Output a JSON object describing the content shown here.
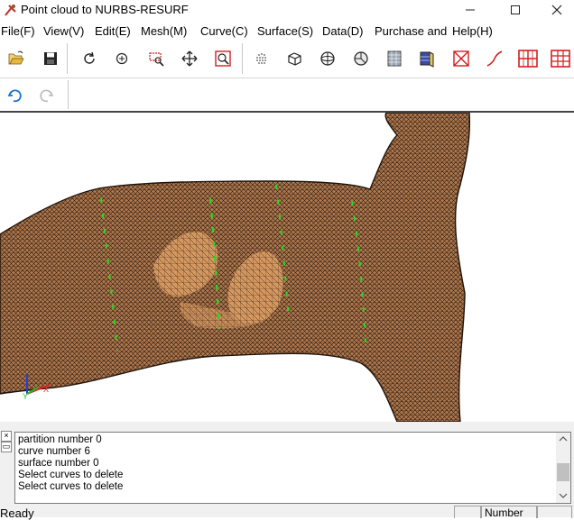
{
  "window": {
    "title": "Point cloud to NURBS-RESURF",
    "controls": [
      "minimize-icon",
      "maximize-icon",
      "close-icon"
    ]
  },
  "menu": [
    "File(F)",
    "View(V)",
    "Edit(E)",
    "Mesh(M)",
    "Curve(C)",
    "Surface(S)",
    "Data(D)",
    "Purchase and",
    "Help(H)"
  ],
  "toolbar": {
    "main_icons": [
      "open-folder-icon",
      "save-disk-icon",
      "rotate-icon",
      "zoom-center-icon",
      "zoom-region-icon",
      "pan-icon",
      "fit-view-icon",
      "point-cloud-icon",
      "cube-wire-icon",
      "sphere-icon",
      "shaded-sphere-icon",
      "scan-object-icon",
      "surface-object-icon",
      "delete-curve-icon",
      "draw-curve-icon",
      "grid-partition-icon",
      "grid-icon"
    ],
    "secondary_icons": [
      "undo-icon",
      "redo-icon"
    ],
    "colors": {
      "red_icons": "#d21f1f",
      "blue_undo": "#1f74c9",
      "disabled": "#b9b9b9"
    }
  },
  "viewport": {
    "mesh_color": "#b27a4e",
    "mesh_line_color": "#2a1a10",
    "highlight_color": "#d99b62",
    "curve_color": "#22dd22",
    "axes": {
      "x": "X",
      "y": "Y",
      "x_color": "#e22020",
      "y_color": "#22bb22",
      "z_color": "#1f3fe0"
    }
  },
  "console": {
    "close_label": "×",
    "pin_label": "▭",
    "lines": [
      "partition number 0",
      "curve number 6",
      "surface number 0",
      "Select curves to delete",
      "Select curves to delete"
    ]
  },
  "statusbar": {
    "text": "Ready",
    "number_label": "Number"
  }
}
